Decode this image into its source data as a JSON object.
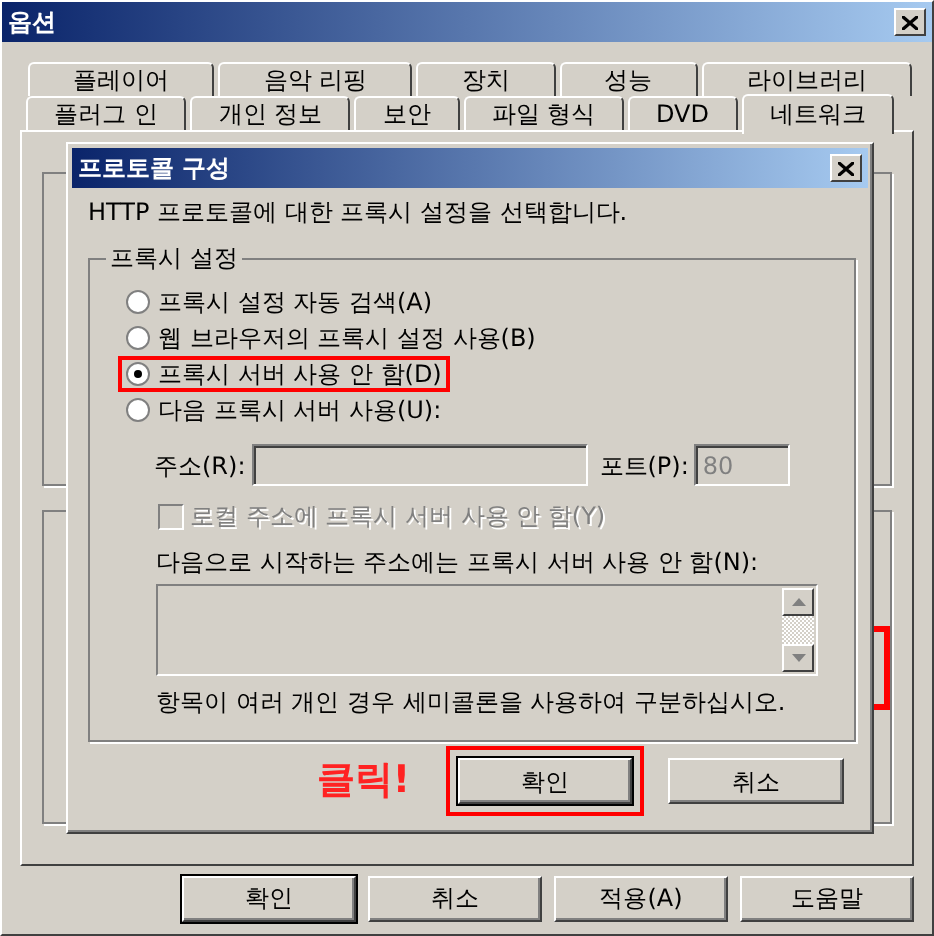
{
  "window": {
    "title": "옵션"
  },
  "tabs_back_row": [
    {
      "label": "플레이어",
      "selected": false
    },
    {
      "label": "음악 리핑",
      "selected": false
    },
    {
      "label": "장치",
      "selected": false
    },
    {
      "label": "성능",
      "selected": false
    },
    {
      "label": "라이브러리",
      "selected": false
    }
  ],
  "tabs_front_row": [
    {
      "label": "플러그 인",
      "selected": false
    },
    {
      "label": "개인 정보",
      "selected": false
    },
    {
      "label": "보안",
      "selected": false
    },
    {
      "label": "파일 형식",
      "selected": false
    },
    {
      "label": "DVD",
      "selected": false
    },
    {
      "label": "네트워크",
      "selected": true
    }
  ],
  "dialog": {
    "title": "프로토콜 구성",
    "description": "HTTP 프로토콜에 대한 프록시 설정을 선택합니다.",
    "group_title": "프록시 설정",
    "proxy_options": [
      {
        "label": "프록시 설정 자동 검색(A)",
        "selected": false,
        "highlighted": false
      },
      {
        "label": "웹 브라우저의 프록시 설정 사용(B)",
        "selected": false,
        "highlighted": false
      },
      {
        "label": "프록시 서버 사용 안 함(D)",
        "selected": true,
        "highlighted": true
      },
      {
        "label": "다음 프록시 서버 사용(U):",
        "selected": false,
        "highlighted": false
      }
    ],
    "proxy_server": {
      "address_label": "주소(R):",
      "port_label": "포트(P):",
      "port_value": "80",
      "disabled": true
    },
    "bypass_local": {
      "label": "로컬 주소에 프록시 서버 사용 안 함(Y)",
      "checked": false,
      "disabled": true
    },
    "exceptions_label": "다음으로 시작하는 주소에는 프록시 서버 사용 안 함(N):",
    "note": "항목이 여러 개인 경우 세미콜론을 사용하여 구분하십시오.",
    "buttons": [
      {
        "label": "확인",
        "default": true,
        "highlighted": true
      },
      {
        "label": "취소",
        "default": false,
        "highlighted": false
      }
    ]
  },
  "annotation": {
    "text": "클릭!"
  },
  "buttons": [
    {
      "label": "확인",
      "default": true
    },
    {
      "label": "취소",
      "default": false
    },
    {
      "label": "적용(A)",
      "default": false
    },
    {
      "label": "도움말",
      "default": false
    }
  ]
}
